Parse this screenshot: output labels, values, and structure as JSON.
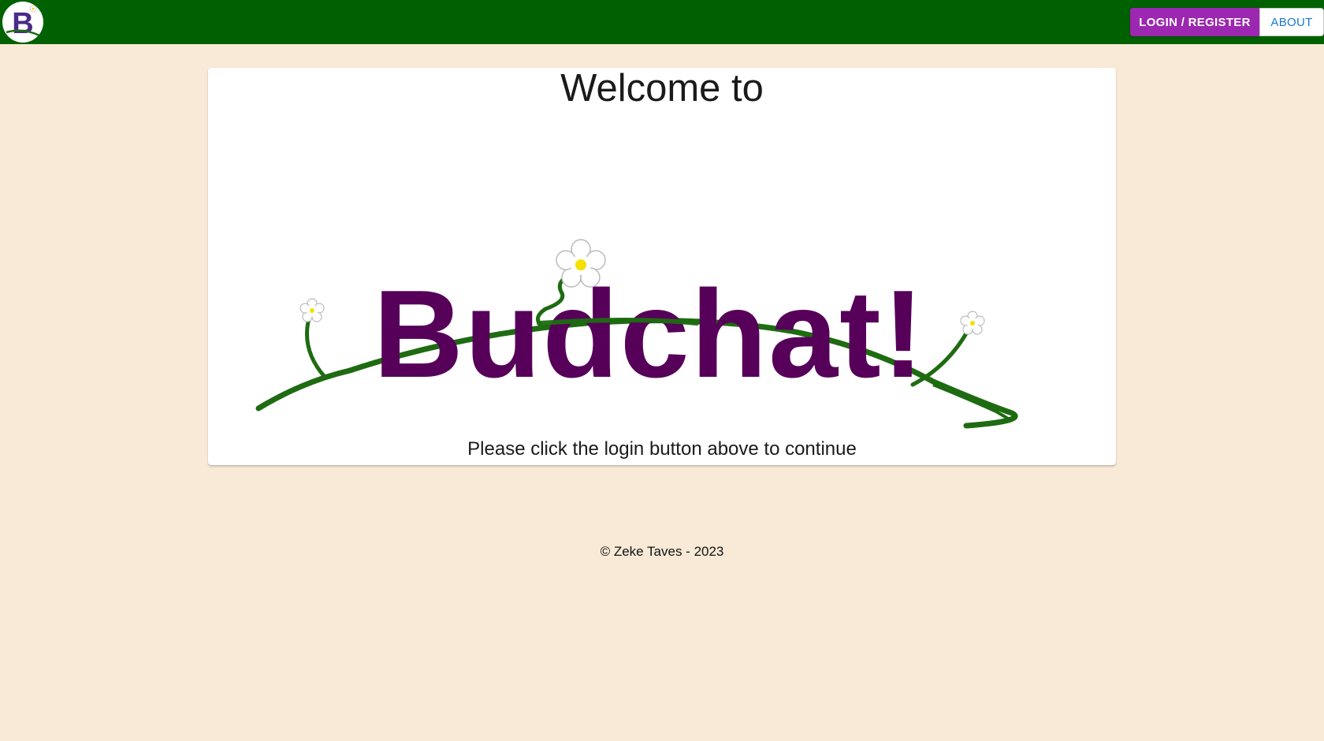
{
  "header": {
    "logo_letter": "B",
    "login_label": "LOGIN / REGISTER",
    "about_label": "ABOUT"
  },
  "main": {
    "welcome_text": "Welcome to",
    "brand_text": "Budchat!",
    "cta_text": "Please click the login button above to continue"
  },
  "footer": {
    "copyright": "© Zeke Taves - 2023"
  },
  "colors": {
    "topbar": "#006100",
    "background": "#f8ead6",
    "login_button": "#9c27b0",
    "about_text": "#1976d2",
    "brand": "#560059",
    "vine": "#1e6b12"
  }
}
